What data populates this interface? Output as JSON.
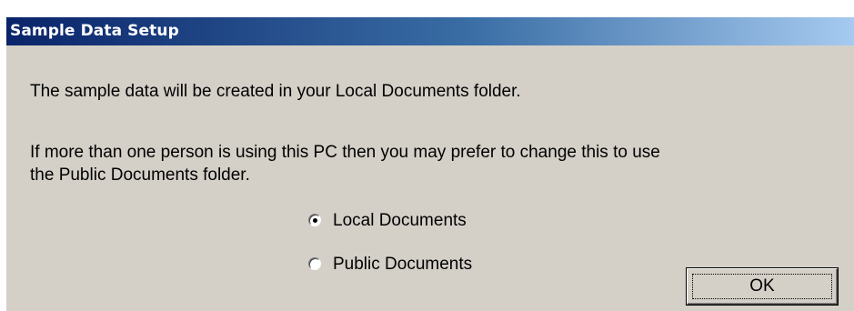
{
  "window": {
    "title": "Sample Data Setup"
  },
  "message": {
    "line1": "The sample data will be created in your Local Documents folder.",
    "line2a": "If more than one person is using this PC then you may prefer to change this to use",
    "line2b": "the Public Documents folder."
  },
  "options": [
    {
      "label": "Local Documents",
      "selected": true
    },
    {
      "label": "Public Documents",
      "selected": false
    }
  ],
  "buttons": {
    "ok_label": "OK"
  },
  "colors": {
    "dialog_background": "#d4d0c8",
    "titlebar_start": "#0a246a",
    "titlebar_end": "#a6caf0",
    "title_text": "#ffffff"
  }
}
